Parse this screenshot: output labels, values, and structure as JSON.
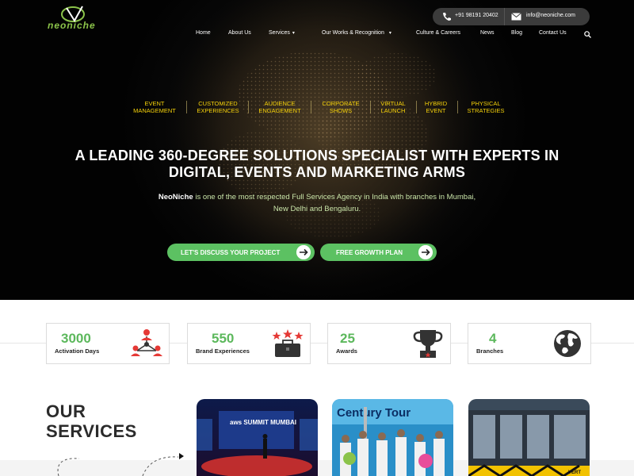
{
  "brand": {
    "logo_text": "neoniche"
  },
  "contact": {
    "phone": "+91 98191 20402",
    "email": "info@neoniche.com"
  },
  "nav": {
    "items": [
      {
        "label": "Home"
      },
      {
        "label": "About Us"
      },
      {
        "label": "Services"
      },
      {
        "label": "Our Works & Recognition"
      },
      {
        "label": "Culture & Careers"
      },
      {
        "label": "News"
      },
      {
        "label": "Blog"
      },
      {
        "label": "Contact Us"
      }
    ],
    "caret": "▾"
  },
  "hero": {
    "services": [
      {
        "line1": "EVENT",
        "line2": "MANAGEMENT"
      },
      {
        "line1": "CUSTOMIZED",
        "line2": "EXPERIENCES"
      },
      {
        "line1": "AUDIENCE",
        "line2": "ENGAGEMENT"
      },
      {
        "line1": "CORPORATE",
        "line2": "SHOWS"
      },
      {
        "line1": "VIRTUAL",
        "line2": "LAUNCH"
      },
      {
        "line1": "HYBRID",
        "line2": "EVENT"
      },
      {
        "line1": "PHYSICAL",
        "line2": "STRATEGIES"
      }
    ],
    "headline_line1": "A LEADING 360-DEGREE SOLUTIONS SPECIALIST WITH EXPERTS IN",
    "headline_line2": "DIGITAL, EVENTS AND MARKETING ARMS",
    "sub_brand": "NeoNiche",
    "sub_rest": " is one of the most respected Full Services Agency in India with branches in Mumbai,",
    "sub_line2": "New Delhi and Bengaluru.",
    "cta_primary": "LET'S DISCUSS YOUR PROJECT",
    "cta_secondary": "FREE GROWTH PLAN"
  },
  "stats": [
    {
      "value": "3000",
      "label": "Activation Days",
      "icon": "network-people-icon"
    },
    {
      "value": "550",
      "label": "Brand Experiences",
      "icon": "briefcase-stars-icon"
    },
    {
      "value": "25",
      "label": "Awards",
      "icon": "trophy-icon"
    },
    {
      "value": "4",
      "label": "Branches",
      "icon": "globe-icon"
    }
  ],
  "services_section": {
    "title_line1": "OUR",
    "title_line2": "SERVICES",
    "cards": [
      {
        "caption": "aws SUMMIT MUMBAI"
      },
      {
        "caption": "Century Tour"
      },
      {
        "caption": "VERT"
      }
    ]
  },
  "colors": {
    "accent_green": "#5cc162",
    "service_yellow": "#f6d20a",
    "icon_red": "#e53935"
  }
}
